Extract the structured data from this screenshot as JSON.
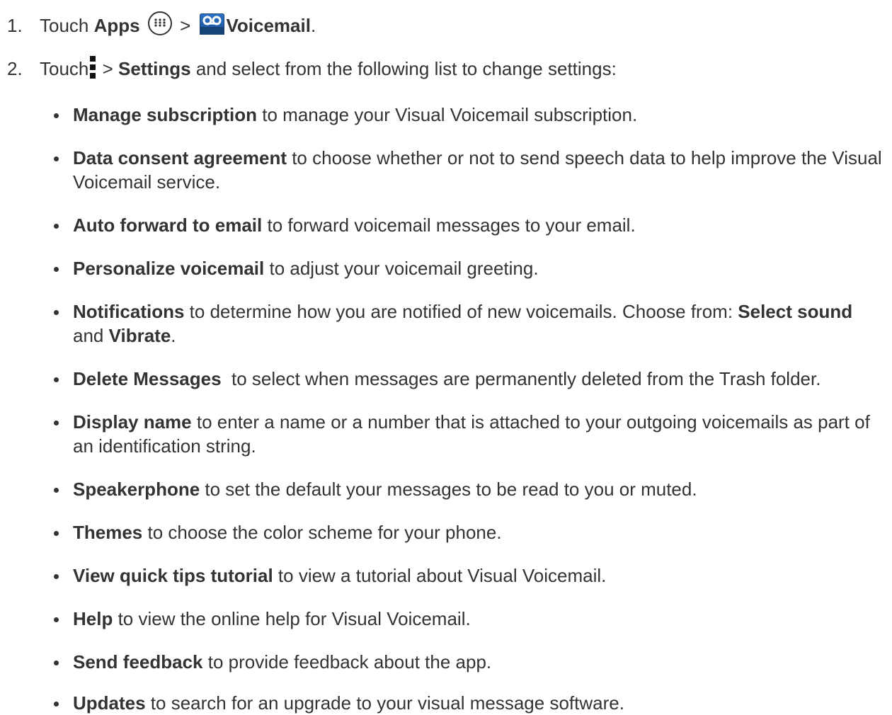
{
  "steps": [
    {
      "number": "1.",
      "pre": "Touch ",
      "bold1": "Apps",
      "sep": " > ",
      "bold2": "Voicemail",
      "post": "."
    },
    {
      "number": "2.",
      "pre": "Touch",
      "sep": " > ",
      "bold1": "Settings",
      "post": " and select from the following list to change settings:"
    }
  ],
  "icons": {
    "apps": "apps-icon",
    "voicemail": "voicemail-icon",
    "menu": "menu-icon"
  },
  "items": [
    {
      "term": "Manage subscription",
      "desc": " to manage your Visual Voicemail subscription."
    },
    {
      "term": "Data consent agreement",
      "desc": " to choose whether or not to send speech data to help improve the Visual Voicemail service."
    },
    {
      "term": "Auto forward to email",
      "desc": " to forward voicemail messages to your email."
    },
    {
      "term": "Personalize voicemail",
      "desc": " to adjust your voicemail greeting."
    },
    {
      "term": "Notifications",
      "desc": " to determine how you are notified of new voicemails. Choose from: ",
      "term2": "Select sound",
      "mid": " and ",
      "term3": "Vibrate",
      "end": "."
    },
    {
      "term": "Delete Messages",
      "desc": "  to select when messages are permanently deleted from the Trash folder."
    },
    {
      "term": "Display name",
      "desc": " to enter a name or a number that is attached to your outgoing voicemails as part of an identification string."
    },
    {
      "term": "Speakerphone",
      "desc": " to set the default your messages to be read to you or muted."
    },
    {
      "term": "Themes",
      "desc": " to choose the color scheme for your phone."
    },
    {
      "term": "View quick tips tutorial",
      "desc": " to view a tutorial about Visual Voicemail."
    },
    {
      "term": "Help",
      "desc": " to view the online help for Visual Voicemail."
    },
    {
      "term": "Send feedback",
      "desc": " to provide feedback about the app."
    },
    {
      "term": "Updates",
      "desc": " to search for an upgrade to your visual message software."
    }
  ]
}
